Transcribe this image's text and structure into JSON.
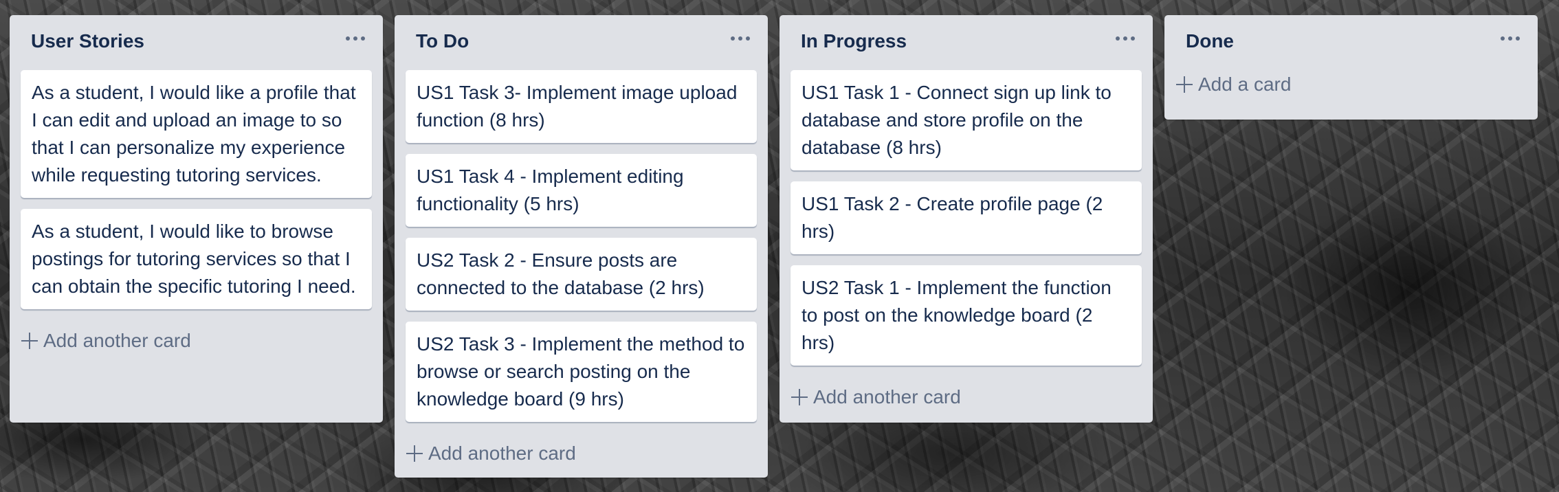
{
  "board": {
    "lists": [
      {
        "title": "User Stories",
        "cards": [
          "As a student, I would like a profile that I can edit and upload an image to so that I can personalize my experience while requesting tutoring services.",
          "As a student, I would like to browse postings for tutoring services so that I can obtain the specific tutoring I need."
        ],
        "add_label": "Add another card"
      },
      {
        "title": "To Do",
        "cards": [
          "US1 Task 3- Implement image upload function (8 hrs)",
          "US1 Task 4 - Implement editing functionality (5 hrs)",
          "US2 Task 2 - Ensure posts are connected to the database (2 hrs)",
          "US2 Task 3 - Implement the method to browse or search posting on the knowledge board (9 hrs)"
        ],
        "add_label": "Add another card"
      },
      {
        "title": "In Progress",
        "cards": [
          "US1 Task 1 - Connect sign up link to database and store profile on the database (8 hrs)",
          "US1 Task 2 - Create profile page (2 hrs)",
          "US2 Task 1 - Implement the function to post on the knowledge board (2 hrs)"
        ],
        "add_label": "Add another card"
      },
      {
        "title": "Done",
        "cards": [],
        "add_label": "Add a card"
      }
    ]
  },
  "icons": {
    "list_menu": "ellipsis-icon",
    "add": "plus-icon"
  },
  "colors": {
    "list_background": "#dfe1e6",
    "card_background": "#ffffff",
    "title_text": "#172b4d",
    "muted_text": "#5e6c84"
  }
}
